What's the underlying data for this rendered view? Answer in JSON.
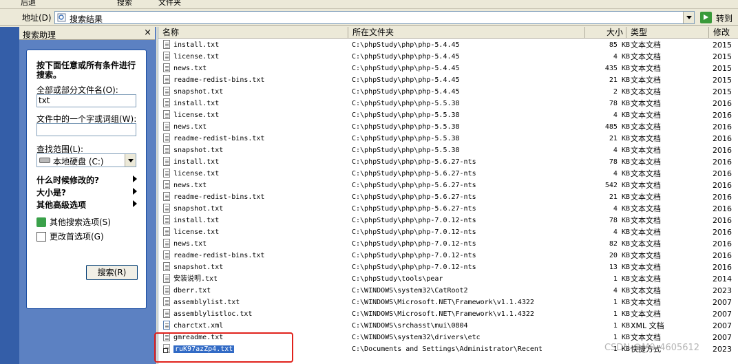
{
  "toolbar": {
    "back_label": "后退",
    "search_label": "搜索",
    "folders_label": "文件夹"
  },
  "address": {
    "label": "地址(D)",
    "value": "搜索结果",
    "go_label": "转到"
  },
  "assistant": {
    "pane_title": "搜索助理",
    "close": "×",
    "heading": "按下面任意或所有条件进行搜索。",
    "name_label": "全部或部分文件名(O):",
    "name_value": "txt",
    "word_label": "文件中的一个字或词组(W):",
    "word_value": "",
    "scope_label": "查找范围(L):",
    "scope_value": "本地硬盘 (C:)",
    "opt_modified": "什么时候修改的?",
    "opt_size": "大小是?",
    "opt_advanced": "其他高级选项",
    "link_other": "其他搜索选项(S)",
    "link_prefs": "更改首选项(G)",
    "search_button": "搜索(R)"
  },
  "columns": {
    "name": "名称",
    "folder": "所在文件夹",
    "size": "大小",
    "type": "类型",
    "date": "修改"
  },
  "files": [
    {
      "name": "install.txt",
      "folder": "C:\\phpStudy\\php\\php-5.4.45",
      "size": "85 KB",
      "type": "文本文档",
      "date": "2015",
      "icon": "txt"
    },
    {
      "name": "license.txt",
      "folder": "C:\\phpStudy\\php\\php-5.4.45",
      "size": "4 KB",
      "type": "文本文档",
      "date": "2015",
      "icon": "txt"
    },
    {
      "name": "news.txt",
      "folder": "C:\\phpStudy\\php\\php-5.4.45",
      "size": "435 KB",
      "type": "文本文档",
      "date": "2015",
      "icon": "txt"
    },
    {
      "name": "readme-redist-bins.txt",
      "folder": "C:\\phpStudy\\php\\php-5.4.45",
      "size": "21 KB",
      "type": "文本文档",
      "date": "2015",
      "icon": "txt"
    },
    {
      "name": "snapshot.txt",
      "folder": "C:\\phpStudy\\php\\php-5.4.45",
      "size": "2 KB",
      "type": "文本文档",
      "date": "2015",
      "icon": "txt"
    },
    {
      "name": "install.txt",
      "folder": "C:\\phpStudy\\php\\php-5.5.38",
      "size": "78 KB",
      "type": "文本文档",
      "date": "2016",
      "icon": "txt"
    },
    {
      "name": "license.txt",
      "folder": "C:\\phpStudy\\php\\php-5.5.38",
      "size": "4 KB",
      "type": "文本文档",
      "date": "2016",
      "icon": "txt"
    },
    {
      "name": "news.txt",
      "folder": "C:\\phpStudy\\php\\php-5.5.38",
      "size": "485 KB",
      "type": "文本文档",
      "date": "2016",
      "icon": "txt"
    },
    {
      "name": "readme-redist-bins.txt",
      "folder": "C:\\phpStudy\\php\\php-5.5.38",
      "size": "21 KB",
      "type": "文本文档",
      "date": "2016",
      "icon": "txt"
    },
    {
      "name": "snapshot.txt",
      "folder": "C:\\phpStudy\\php\\php-5.5.38",
      "size": "4 KB",
      "type": "文本文档",
      "date": "2016",
      "icon": "txt"
    },
    {
      "name": "install.txt",
      "folder": "C:\\phpStudy\\php\\php-5.6.27-nts",
      "size": "78 KB",
      "type": "文本文档",
      "date": "2016",
      "icon": "txt"
    },
    {
      "name": "license.txt",
      "folder": "C:\\phpStudy\\php\\php-5.6.27-nts",
      "size": "4 KB",
      "type": "文本文档",
      "date": "2016",
      "icon": "txt"
    },
    {
      "name": "news.txt",
      "folder": "C:\\phpStudy\\php\\php-5.6.27-nts",
      "size": "542 KB",
      "type": "文本文档",
      "date": "2016",
      "icon": "txt"
    },
    {
      "name": "readme-redist-bins.txt",
      "folder": "C:\\phpStudy\\php\\php-5.6.27-nts",
      "size": "21 KB",
      "type": "文本文档",
      "date": "2016",
      "icon": "txt"
    },
    {
      "name": "snapshot.txt",
      "folder": "C:\\phpStudy\\php\\php-5.6.27-nts",
      "size": "4 KB",
      "type": "文本文档",
      "date": "2016",
      "icon": "txt"
    },
    {
      "name": "install.txt",
      "folder": "C:\\phpStudy\\php\\php-7.0.12-nts",
      "size": "78 KB",
      "type": "文本文档",
      "date": "2016",
      "icon": "txt"
    },
    {
      "name": "license.txt",
      "folder": "C:\\phpStudy\\php\\php-7.0.12-nts",
      "size": "4 KB",
      "type": "文本文档",
      "date": "2016",
      "icon": "txt"
    },
    {
      "name": "news.txt",
      "folder": "C:\\phpStudy\\php\\php-7.0.12-nts",
      "size": "82 KB",
      "type": "文本文档",
      "date": "2016",
      "icon": "txt"
    },
    {
      "name": "readme-redist-bins.txt",
      "folder": "C:\\phpStudy\\php\\php-7.0.12-nts",
      "size": "20 KB",
      "type": "文本文档",
      "date": "2016",
      "icon": "txt"
    },
    {
      "name": "snapshot.txt",
      "folder": "C:\\phpStudy\\php\\php-7.0.12-nts",
      "size": "13 KB",
      "type": "文本文档",
      "date": "2016",
      "icon": "txt"
    },
    {
      "name": "安装说明.txt",
      "folder": "C:\\phpStudy\\tools\\pear",
      "size": "1 KB",
      "type": "文本文档",
      "date": "2014",
      "icon": "txt"
    },
    {
      "name": "dberr.txt",
      "folder": "C:\\WINDOWS\\system32\\CatRoot2",
      "size": "4 KB",
      "type": "文本文档",
      "date": "2023",
      "icon": "txt"
    },
    {
      "name": "assemblylist.txt",
      "folder": "C:\\WINDOWS\\Microsoft.NET\\Framework\\v1.1.4322",
      "size": "1 KB",
      "type": "文本文档",
      "date": "2007",
      "icon": "txt"
    },
    {
      "name": "assemblylistloc.txt",
      "folder": "C:\\WINDOWS\\Microsoft.NET\\Framework\\v1.1.4322",
      "size": "1 KB",
      "type": "文本文档",
      "date": "2007",
      "icon": "txt"
    },
    {
      "name": "charctxt.xml",
      "folder": "C:\\WINDOWS\\srchasst\\mui\\0804",
      "size": "1 KB",
      "type": "XML 文档",
      "date": "2007",
      "icon": "xml"
    },
    {
      "name": "gmreadme.txt",
      "folder": "C:\\WINDOWS\\system32\\drivers\\etc",
      "size": "1 KB",
      "type": "文本文档",
      "date": "2007",
      "icon": "txt"
    },
    {
      "name": "ruK97azZp4.txt",
      "folder": "C:\\Documents and Settings\\Administrator\\Recent",
      "size": "1 KB",
      "type": "快捷方式",
      "date": "2023",
      "icon": "lnk",
      "selected": true
    }
  ],
  "watermark": "CSDN @M0_4605612",
  "colors": {
    "selection": "#316ac5",
    "highlight_box": "#e0211b",
    "pane_blue": "#5c81c2"
  }
}
